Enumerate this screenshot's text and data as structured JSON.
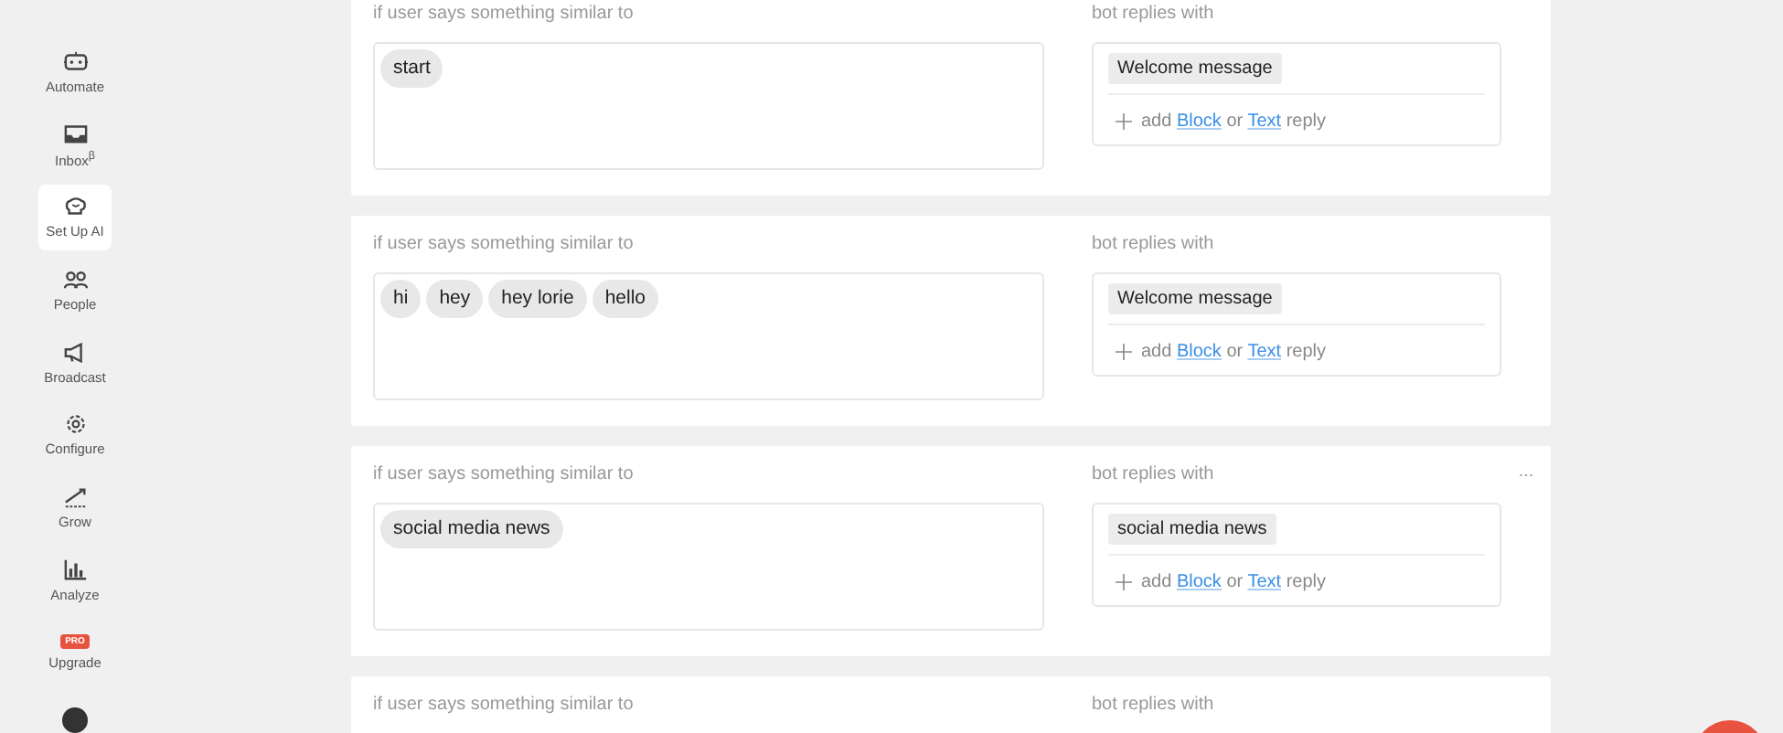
{
  "sidebar": {
    "items": [
      {
        "label": "Automate",
        "selected": false
      },
      {
        "label": "Inbox$^{β}$",
        "selected": false
      },
      {
        "label": "Set Up AI",
        "selected": true
      },
      {
        "label": "People",
        "selected": false
      },
      {
        "label": "Broadcast",
        "selected": false
      },
      {
        "label": "Configure",
        "selected": false
      },
      {
        "label": "Grow",
        "selected": false
      },
      {
        "label": "Analyze",
        "selected": false
      },
      {
        "label": "Upgrade",
        "selected": false,
        "badge": "PRO"
      }
    ]
  },
  "rules": [
    {
      "trigger_label": "if user says something similar to",
      "keywords": [
        "start"
      ],
      "reply_label": "bot replies with",
      "replies": [
        "Welcome message"
      ],
      "add_prefix": "add",
      "block_link": "Block",
      "or_word": "or",
      "text_link": "Text",
      "add_suffix": "reply",
      "has_menu": false
    },
    {
      "trigger_label": "if user says something similar to",
      "keywords": [
        "hi",
        "hey",
        "hey lorie",
        "hello"
      ],
      "reply_label": "bot replies with",
      "replies": [
        "Welcome message"
      ],
      "add_prefix": "add",
      "block_link": "Block",
      "or_word": "or",
      "text_link": "Text",
      "add_suffix": "reply",
      "has_menu": false
    },
    {
      "trigger_label": "if user says something similar to",
      "keywords": [
        "social media news"
      ],
      "reply_label": "bot replies with",
      "replies": [
        "social media news"
      ],
      "add_prefix": "add",
      "block_link": "Block",
      "or_word": "or",
      "text_link": "Text",
      "add_suffix": "reply",
      "has_menu": true
    },
    {
      "trigger_label": "if user says something similar to",
      "reply_label": "bot replies with",
      "has_menu": false
    }
  ]
}
